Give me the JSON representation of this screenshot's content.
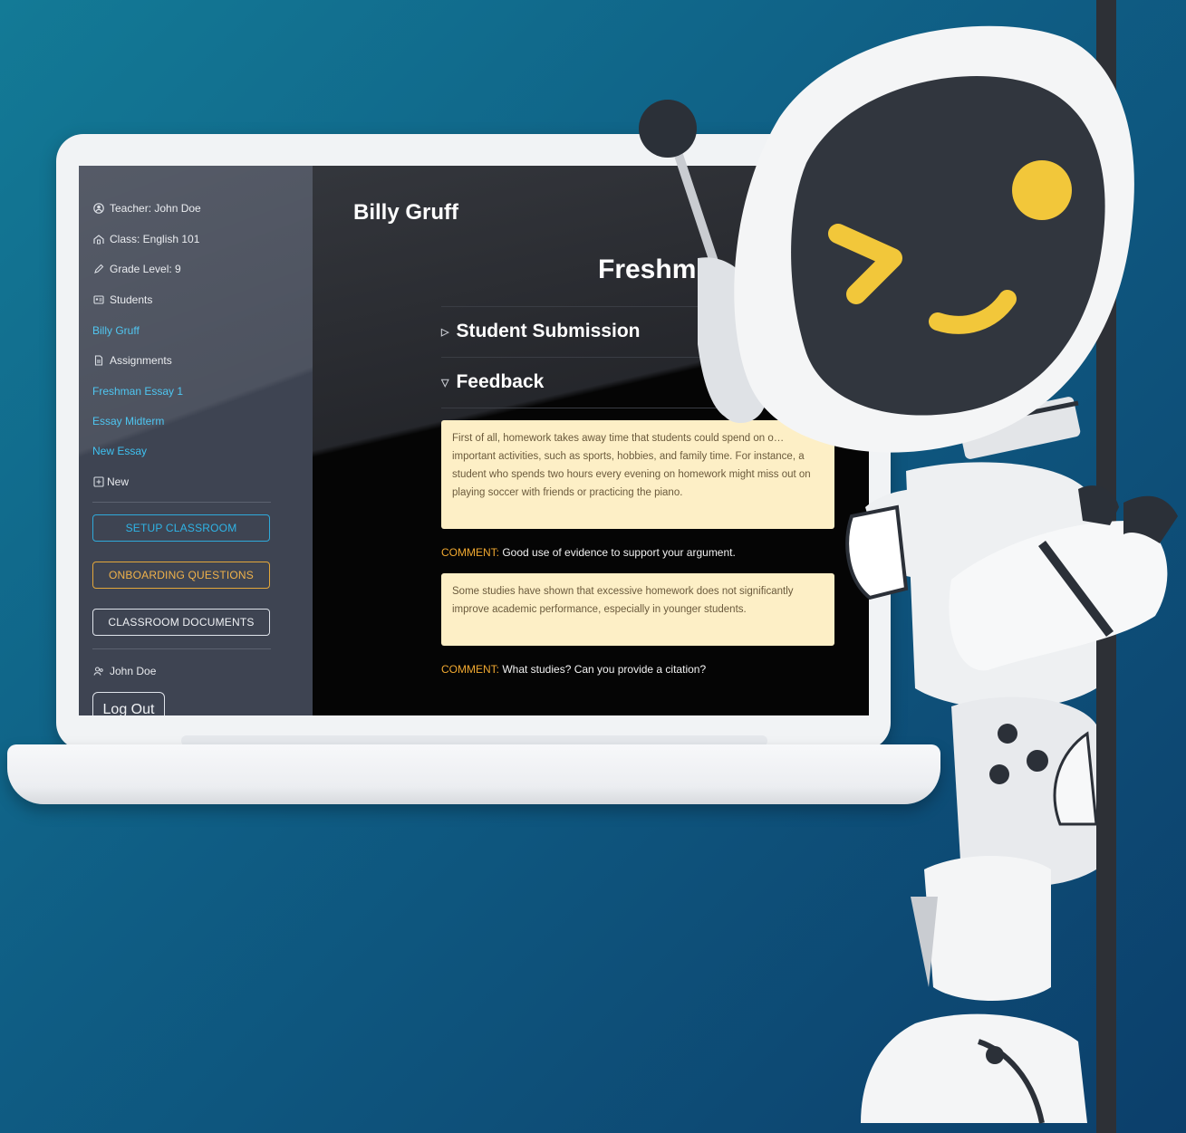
{
  "sidebar": {
    "teacher": "Teacher: John Doe",
    "class": "Class: English 101",
    "grade": "Grade Level: 9",
    "students_label": "Students",
    "students": [
      "Billy Gruff"
    ],
    "assignments_label": "Assignments",
    "assignments": [
      "Freshman Essay 1",
      "Essay Midterm",
      "New Essay"
    ],
    "new_label": "New",
    "setup_button": "SETUP CLASSROOM",
    "onboarding_button": "ONBOARDING QUESTIONS",
    "documents_button": "CLASSROOM DOCUMENTS",
    "user": "John Doe",
    "logout": "Log Out"
  },
  "main": {
    "student_name": "Billy Gruff",
    "essay_title": "Freshm",
    "sections": {
      "submission": "Student Submission",
      "feedback": "Feedback"
    },
    "feedback_items": [
      {
        "excerpt": "First of all, homework takes away time that students could spend on o… important activities, such as sports, hobbies, and family time. For instance, a student who spends two hours every evening on homework might miss out on playing soccer with friends or practicing the piano.",
        "comment_tag": "COMMENT:",
        "comment": " Good use of evidence to support your argument."
      },
      {
        "excerpt": "Some studies have shown that excessive homework does not significantly improve academic performance, especially in younger students.",
        "comment_tag": "COMMENT:",
        "comment": " What studies? Can you provide a citation?"
      }
    ]
  },
  "colors": {
    "background": "#0f5d84",
    "sidebar": "#3e4452",
    "link": "#3fc1f0",
    "accent_orange": "#f0a830",
    "feedback_box": "#fdefc6",
    "robot_eye": "#f2c73a"
  }
}
